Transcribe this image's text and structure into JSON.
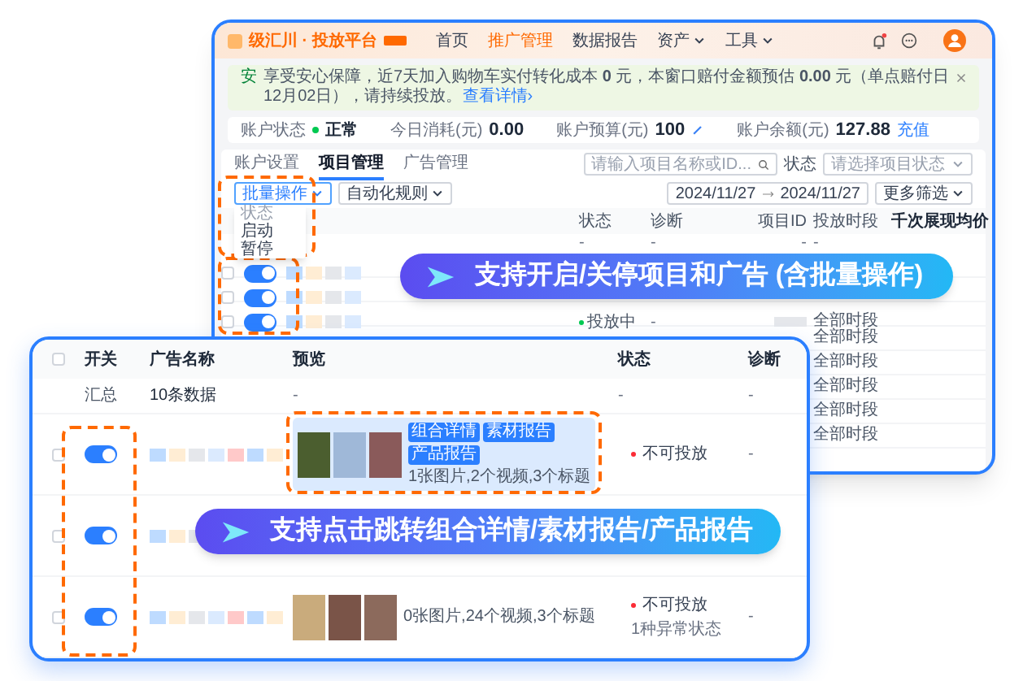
{
  "back_window": {
    "logo": "级汇川 · 投放平台",
    "nav": [
      {
        "label": "首页",
        "selected": false,
        "dropdown": false
      },
      {
        "label": "推广管理",
        "selected": true,
        "dropdown": false
      },
      {
        "label": "数据报告",
        "selected": false,
        "dropdown": false
      },
      {
        "label": "资产",
        "selected": false,
        "dropdown": true
      },
      {
        "label": "工具",
        "selected": false,
        "dropdown": true
      }
    ],
    "notice": {
      "badge": "安",
      "text": "享受安心保障，近7天加入购物车实付转化成本 **0** 元，本窗口赔付金额预估 **0.00** 元（单点赔付日12月02日），请持续投放。",
      "link": "查看详情›"
    },
    "stats": [
      {
        "label": "账户状态",
        "value": "正常",
        "kind": "status"
      },
      {
        "label": "今日消耗(元)",
        "value": "0.00",
        "kind": "number"
      },
      {
        "label": "账户预算(元)",
        "value": "100",
        "kind": "editable"
      },
      {
        "label": "账户余额(元)",
        "value": "127.88",
        "kind": "recharge",
        "action": "充值"
      }
    ],
    "tabs": [
      {
        "label": "账户设置",
        "selected": false
      },
      {
        "label": "项目管理",
        "selected": true
      },
      {
        "label": "广告管理",
        "selected": false
      }
    ],
    "search": {
      "placeholder": "请输入项目名称或ID..."
    },
    "status_filter": {
      "label": "状态",
      "placeholder": "请选择项目状态"
    },
    "date_range": {
      "start": "2024/11/27",
      "end": "2024/11/27"
    },
    "more_filters": "更多筛选",
    "bulk_button": "批量操作",
    "rule_button": "自动化规则",
    "bulk_menu": {
      "header": "状态",
      "items": [
        "启动",
        "暂停"
      ]
    },
    "columns": [
      "状态",
      "诊断",
      "项目ID",
      "投放时段",
      "千次展现均价"
    ],
    "summary": [
      "-",
      "-",
      "-",
      "-"
    ],
    "rows": [
      {
        "checked": false,
        "on": true
      },
      {
        "checked": false,
        "on": true
      },
      {
        "checked": false,
        "on": true,
        "status": "投放中",
        "diagnosis": "-",
        "schedule": "全部时段"
      },
      {
        "schedule": "全部时段"
      },
      {
        "schedule": "全部时段"
      },
      {
        "schedule": "全部时段"
      },
      {
        "schedule": "全部时段"
      },
      {
        "schedule": "全部时段"
      }
    ]
  },
  "banners": [
    {
      "text": "支持开启/关停项目和广告 (含批量操作)"
    },
    {
      "text": "支持点击跳转组合详情/素材报告/产品报告"
    }
  ],
  "front_window": {
    "header_checked": false,
    "columns": [
      "开关",
      "广告名称",
      "预览",
      "状态",
      "诊断"
    ],
    "summary": {
      "label": "汇总",
      "count": "10条数据",
      "cells": [
        "-",
        "-",
        "-"
      ]
    },
    "rows": [
      {
        "checked": false,
        "on": true,
        "links": [
          "组合详情",
          "素材报告",
          "产品报告"
        ],
        "preview_text": "1张图片,2个视频,3个标题",
        "status": "不可投放",
        "diagnosis": "-"
      },
      {
        "checked": false,
        "on": true
      },
      {
        "checked": false,
        "on": true,
        "preview_text": "0张图片,24个视频,3个标题",
        "status": "不可投放",
        "status_note": "1种异常状态",
        "diagnosis": "-"
      }
    ]
  }
}
